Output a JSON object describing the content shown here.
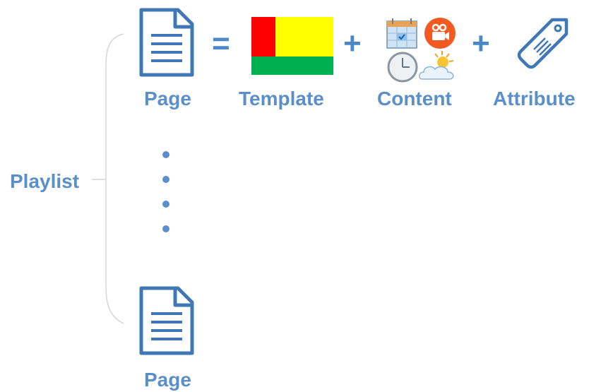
{
  "labels": {
    "page_top": "Page",
    "template": "Template",
    "content": "Content",
    "attribute": "Attribute",
    "playlist": "Playlist",
    "page_bottom": "Page"
  },
  "operators": {
    "equals": "=",
    "plus_1": "+",
    "plus_2": "+"
  },
  "icons": {
    "page_top": "document-icon",
    "template": "template-layout-icon",
    "calendar": "calendar-icon",
    "video": "video-camera-icon",
    "clock": "clock-icon",
    "weather": "weather-icon",
    "attribute": "tag-icon",
    "page_bottom": "document-icon"
  },
  "colors": {
    "label_blue": "#5b8fc9",
    "icon_blue": "#3f78b5",
    "template_red": "#ff0000",
    "template_yellow": "#ffff00",
    "template_green": "#00b050",
    "video_orange": "#f25a22",
    "bracket_gray": "#d6d6d6"
  }
}
